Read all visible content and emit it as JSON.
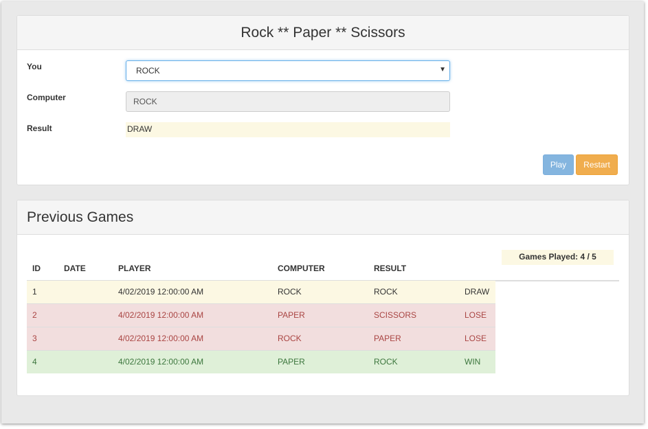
{
  "game": {
    "title": "Rock ** Paper ** Scissors",
    "you_label": "You",
    "you_value": "ROCK",
    "computer_label": "Computer",
    "computer_value": "ROCK",
    "result_label": "Result",
    "result_value": "DRAW",
    "play_label": "Play",
    "restart_label": "Restart"
  },
  "history": {
    "title": "Previous Games",
    "games_played": "Games Played: 4 / 5",
    "columns": [
      "ID",
      "DATE",
      "PLAYER",
      "COMPUTER",
      "RESULT"
    ],
    "rows": [
      {
        "id": "1",
        "date": "",
        "player": "4/02/2019 12:00:00 AM",
        "computer": "ROCK",
        "result": "ROCK",
        "outcome": "DRAW",
        "status": "warning"
      },
      {
        "id": "2",
        "date": "",
        "player": "4/02/2019 12:00:00 AM",
        "computer": "PAPER",
        "result": "SCISSORS",
        "outcome": "LOSE",
        "status": "danger"
      },
      {
        "id": "3",
        "date": "",
        "player": "4/02/2019 12:00:00 AM",
        "computer": "ROCK",
        "result": "PAPER",
        "outcome": "LOSE",
        "status": "danger"
      },
      {
        "id": "4",
        "date": "",
        "player": "4/02/2019 12:00:00 AM",
        "computer": "PAPER",
        "result": "ROCK",
        "outcome": "WIN",
        "status": "success"
      }
    ]
  },
  "colors": {
    "warning": "#fcf8e3",
    "danger": "#f2dede",
    "success": "#dff0d8",
    "play_button": "#84b5df",
    "restart_button": "#f0ad4e"
  },
  "icons": {
    "select_caret": "caret-down-icon"
  }
}
